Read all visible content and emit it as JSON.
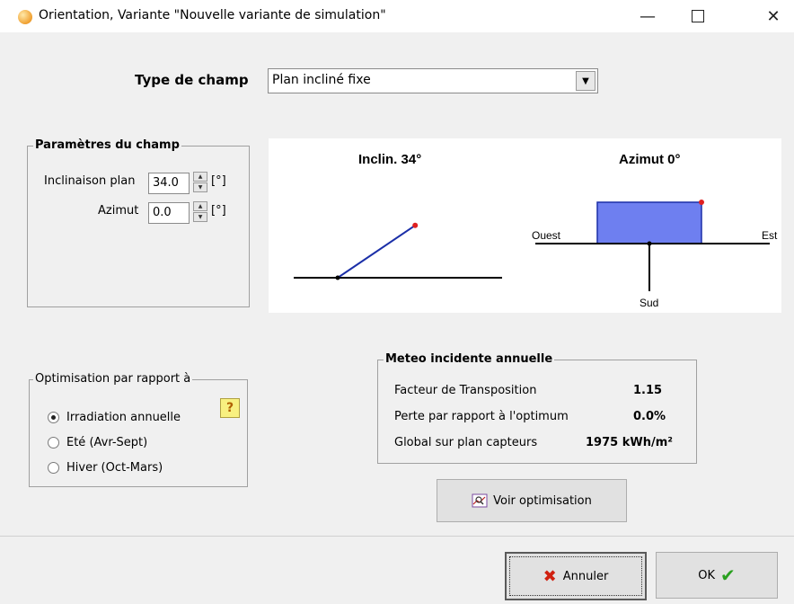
{
  "window": {
    "title": "Orientation, Variante \"Nouvelle variante de simulation\"",
    "app_icon": "sun-icon",
    "controls": {
      "minimize": "—",
      "close": "✕"
    }
  },
  "field_type": {
    "label": "Type de champ",
    "selected": "Plan incliné fixe"
  },
  "params": {
    "title": "Paramètres du champ",
    "tilt_label": "Inclinaison plan",
    "tilt_value": "34.0",
    "tilt_unit": "[°]",
    "azimuth_label": "Azimut",
    "azimuth_value": "0.0",
    "azimuth_unit": "[°]"
  },
  "diagram": {
    "tilt_title": "Inclin. 34°",
    "azimuth_title": "Azimut 0°",
    "west": "Ouest",
    "east": "Est",
    "south": "Sud",
    "tilt_degrees": 34,
    "azimuth_degrees": 0,
    "colors": {
      "plane": "#6e7ff0",
      "line": "#1b2fa8",
      "marker": "#e02020"
    }
  },
  "optimisation": {
    "title": "Optimisation par rapport à",
    "options": [
      {
        "label": "Irradiation annuelle",
        "checked": true
      },
      {
        "label": "Eté (Avr-Sept)",
        "checked": false
      },
      {
        "label": "Hiver (Oct-Mars)",
        "checked": false
      }
    ],
    "help": "?"
  },
  "meteo": {
    "title": "Meteo incidente annuelle",
    "rows": [
      {
        "label": "Facteur de Transposition",
        "value": "1.15"
      },
      {
        "label": "Perte par rapport à l'optimum",
        "value": "0.0%"
      },
      {
        "label": "Global sur plan capteurs",
        "value": "1975 kWh/m²"
      }
    ]
  },
  "buttons": {
    "voir": "Voir optimisation",
    "annuler": "Annuler",
    "ok": "OK"
  }
}
